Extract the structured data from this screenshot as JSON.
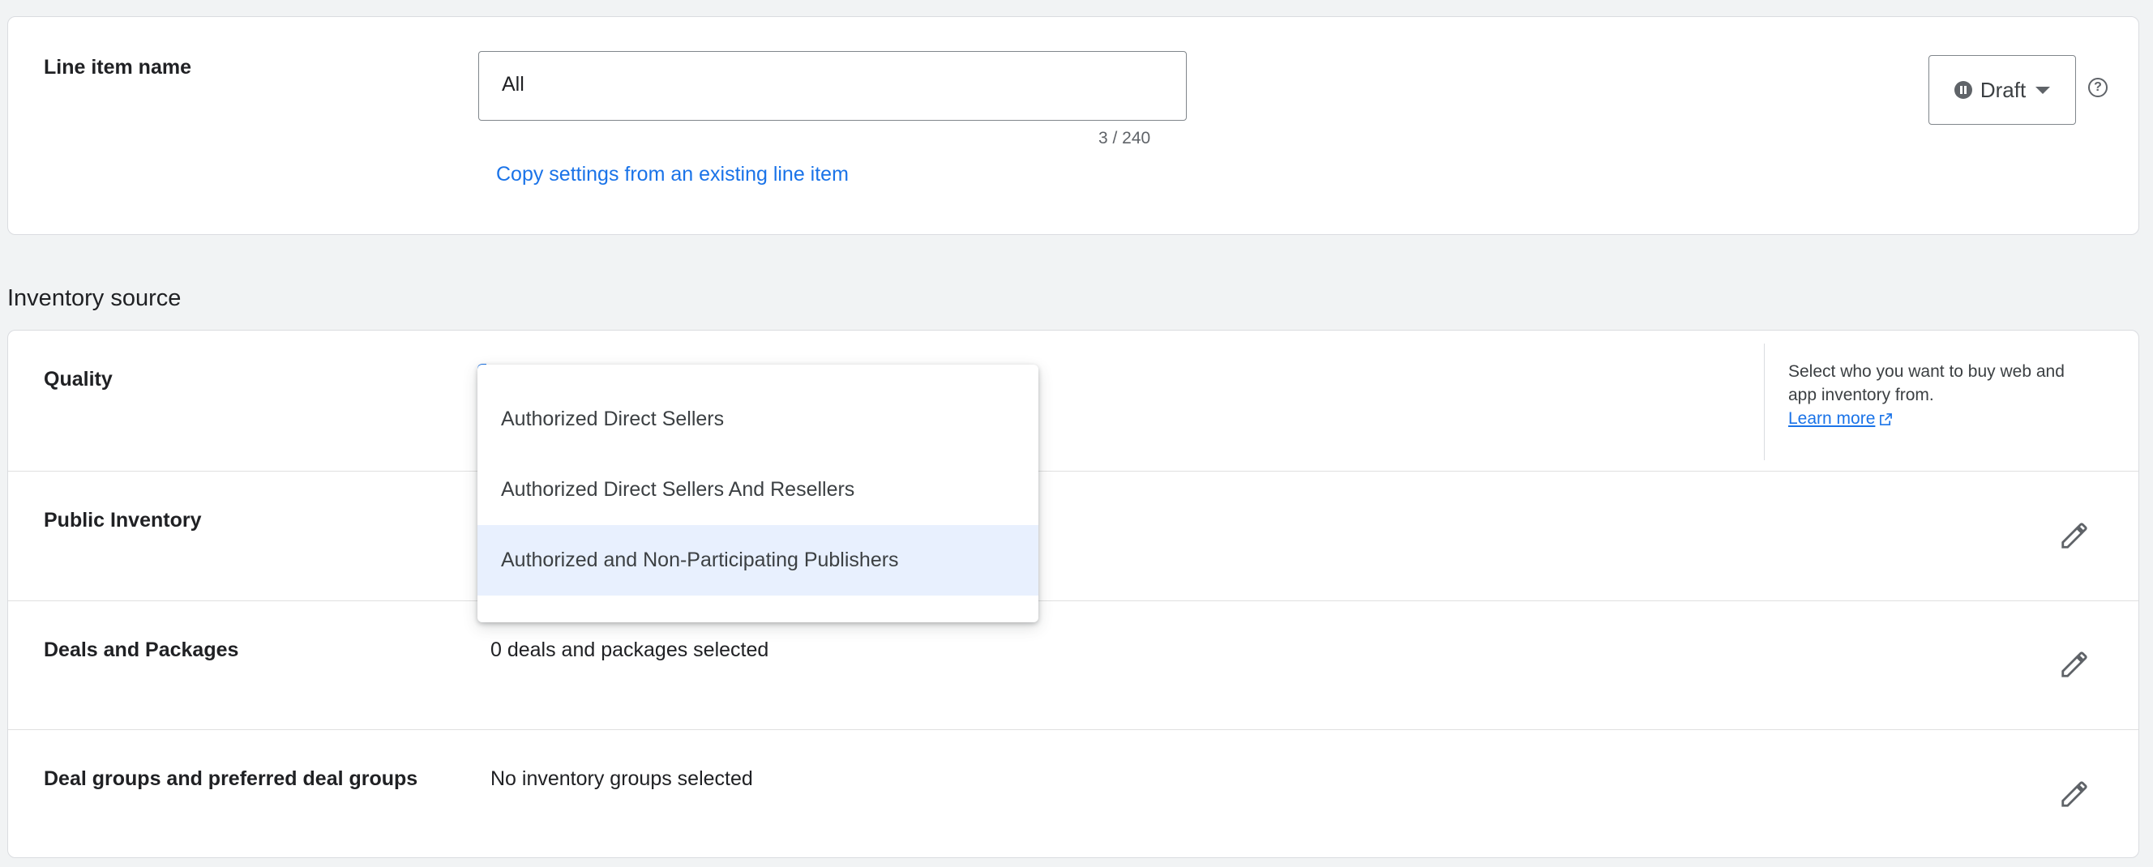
{
  "line_item": {
    "label": "Line item name",
    "name_value": "All",
    "char_counter": "3 / 240",
    "copy_link": "Copy settings from an existing line item",
    "status": "Draft"
  },
  "inventory": {
    "section_title": "Inventory source",
    "quality": {
      "label": "Quality",
      "helper_text": "Select who you want to buy web and app inventory from.",
      "learn_more": "Learn more"
    },
    "dropdown_options": [
      "Authorized Direct Sellers",
      "Authorized Direct Sellers And Resellers",
      "Authorized and Non-Participating Publishers"
    ],
    "selected_option_index": 2,
    "public_inventory": {
      "label": "Public Inventory"
    },
    "deals": {
      "label": "Deals and Packages",
      "value": "0 deals and packages selected"
    },
    "deal_groups": {
      "label": "Deal groups and preferred deal groups",
      "value": "No inventory groups selected"
    }
  },
  "colors": {
    "accent": "#1a73e8",
    "selected_option_bg": "#e8f0fe",
    "page_bg": "#f1f3f4"
  }
}
